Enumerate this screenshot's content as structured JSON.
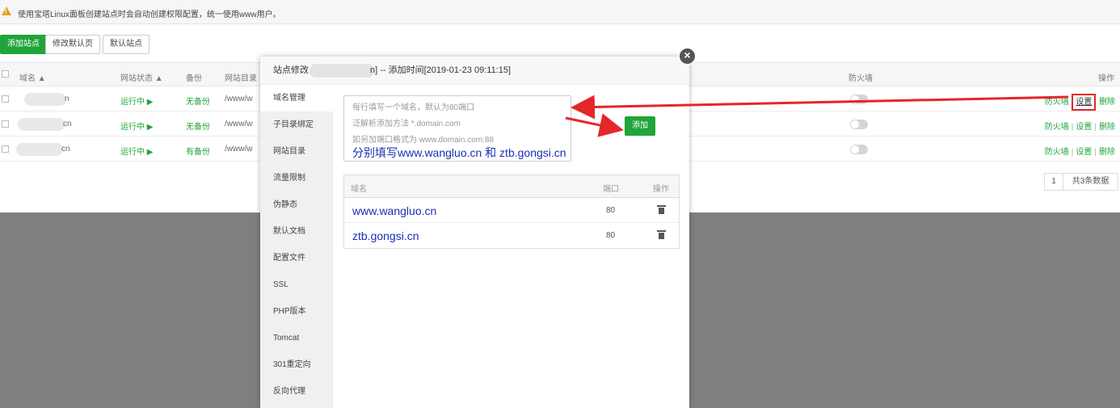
{
  "notice": {
    "icon": "warning-icon",
    "text": "使用宝塔Linux面板创建站点时会自动创建权限配置，统一使用www用户。"
  },
  "toolbar": {
    "add_site": "添加站点",
    "edit_default_page": "修改默认页",
    "default_site": "默认站点"
  },
  "table": {
    "headers": {
      "domain": "域名 ▲",
      "status": "网站状态 ▲",
      "backup": "备份",
      "root": "网站目录",
      "firewall": "防火墙",
      "ops": "操作"
    },
    "rows": [
      {
        "domain_suffix": "n",
        "status": "运行中 ▶",
        "backup": "无备份",
        "root": "/www/w",
        "ops": {
          "firewall": "防火墙",
          "settings": "设置",
          "delete": "删除"
        }
      },
      {
        "domain_suffix": "cn",
        "status": "运行中 ▶",
        "backup": "无备份",
        "root": "/www/w",
        "ops": {
          "firewall": "防火墙",
          "settings": "设置",
          "delete": "删除"
        }
      },
      {
        "domain_suffix": "cn",
        "status": "运行中 ▶",
        "backup": "有备份",
        "root": "/www/w",
        "ops": {
          "firewall": "防火墙",
          "settings": "设置",
          "delete": "删除"
        }
      }
    ],
    "pager": {
      "page": "1",
      "total": "共3条数据"
    }
  },
  "modal": {
    "title_prefix": "站点修改",
    "title_suffix": "n] -- 添加时间[2019-01-23 09:11:15]",
    "close": "×",
    "sidebar": [
      "域名管理",
      "子目录绑定",
      "网站目录",
      "流量限制",
      "伪静态",
      "默认文档",
      "配置文件",
      "SSL",
      "PHP版本",
      "Tomcat",
      "301重定向",
      "反向代理"
    ],
    "textarea_placeholder": [
      "每行填写一个域名，默认为80端口",
      "泛解析添加方法 *.domain.com",
      "如另加端口格式为 www.domain.com:88"
    ],
    "add_button": "添加",
    "instruction": "分别填写www.wangluo.cn 和 ztb.gongsi.cn",
    "domain_table": {
      "headers": {
        "domain": "域名",
        "port": "端口",
        "ops": "操作"
      },
      "rows": [
        {
          "domain": "www.wangluo.cn",
          "port": "80"
        },
        {
          "domain": "ztb.gongsi.cn",
          "port": "80"
        }
      ]
    }
  },
  "colors": {
    "accent_green": "#20a53a",
    "annotation_red": "#e5262a",
    "annotation_blue": "#1a2fb4"
  }
}
